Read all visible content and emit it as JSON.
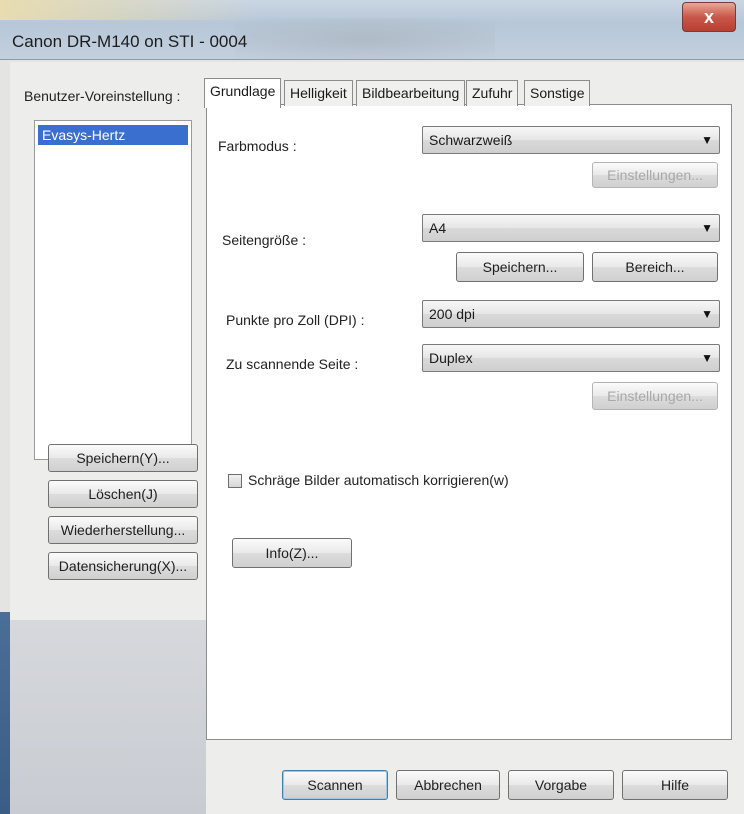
{
  "window": {
    "title": "Canon DR-M140 on STI - 0004",
    "close_label": "x"
  },
  "presets": {
    "label": "Benutzer-Voreinstellung :",
    "items": [
      "Evasys-Hertz"
    ],
    "buttons": {
      "save": "Speichern(Y)...",
      "delete": "Löschen(J)",
      "restore": "Wiederherstellung...",
      "backup": "Datensicherung(X)..."
    }
  },
  "tabs": [
    {
      "label": "Grundlage",
      "active": true
    },
    {
      "label": "Helligkeit",
      "active": false
    },
    {
      "label": "Bildbearbeitung",
      "active": false
    },
    {
      "label": "Zufuhr",
      "active": false
    },
    {
      "label": "Sonstige",
      "active": false
    }
  ],
  "basic": {
    "color_mode_label": "Farbmodus :",
    "color_mode_value": "Schwarzweiß",
    "color_settings_btn": "Einstellungen...",
    "page_size_label": "Seitengröße :",
    "page_size_value": "A4",
    "save_btn": "Speichern...",
    "area_btn": "Bereich...",
    "dpi_label": "Punkte pro Zoll (DPI) :",
    "dpi_value": "200 dpi",
    "side_label": "Zu scannende Seite :",
    "side_value": "Duplex",
    "side_settings_btn": "Einstellungen...",
    "deskew_label": "Schräge Bilder automatisch korrigieren(w)",
    "deskew_checked": false,
    "info_btn": "Info(Z)..."
  },
  "footer": {
    "scan": "Scannen",
    "cancel": "Abbrechen",
    "default": "Vorgabe",
    "help": "Hilfe"
  }
}
